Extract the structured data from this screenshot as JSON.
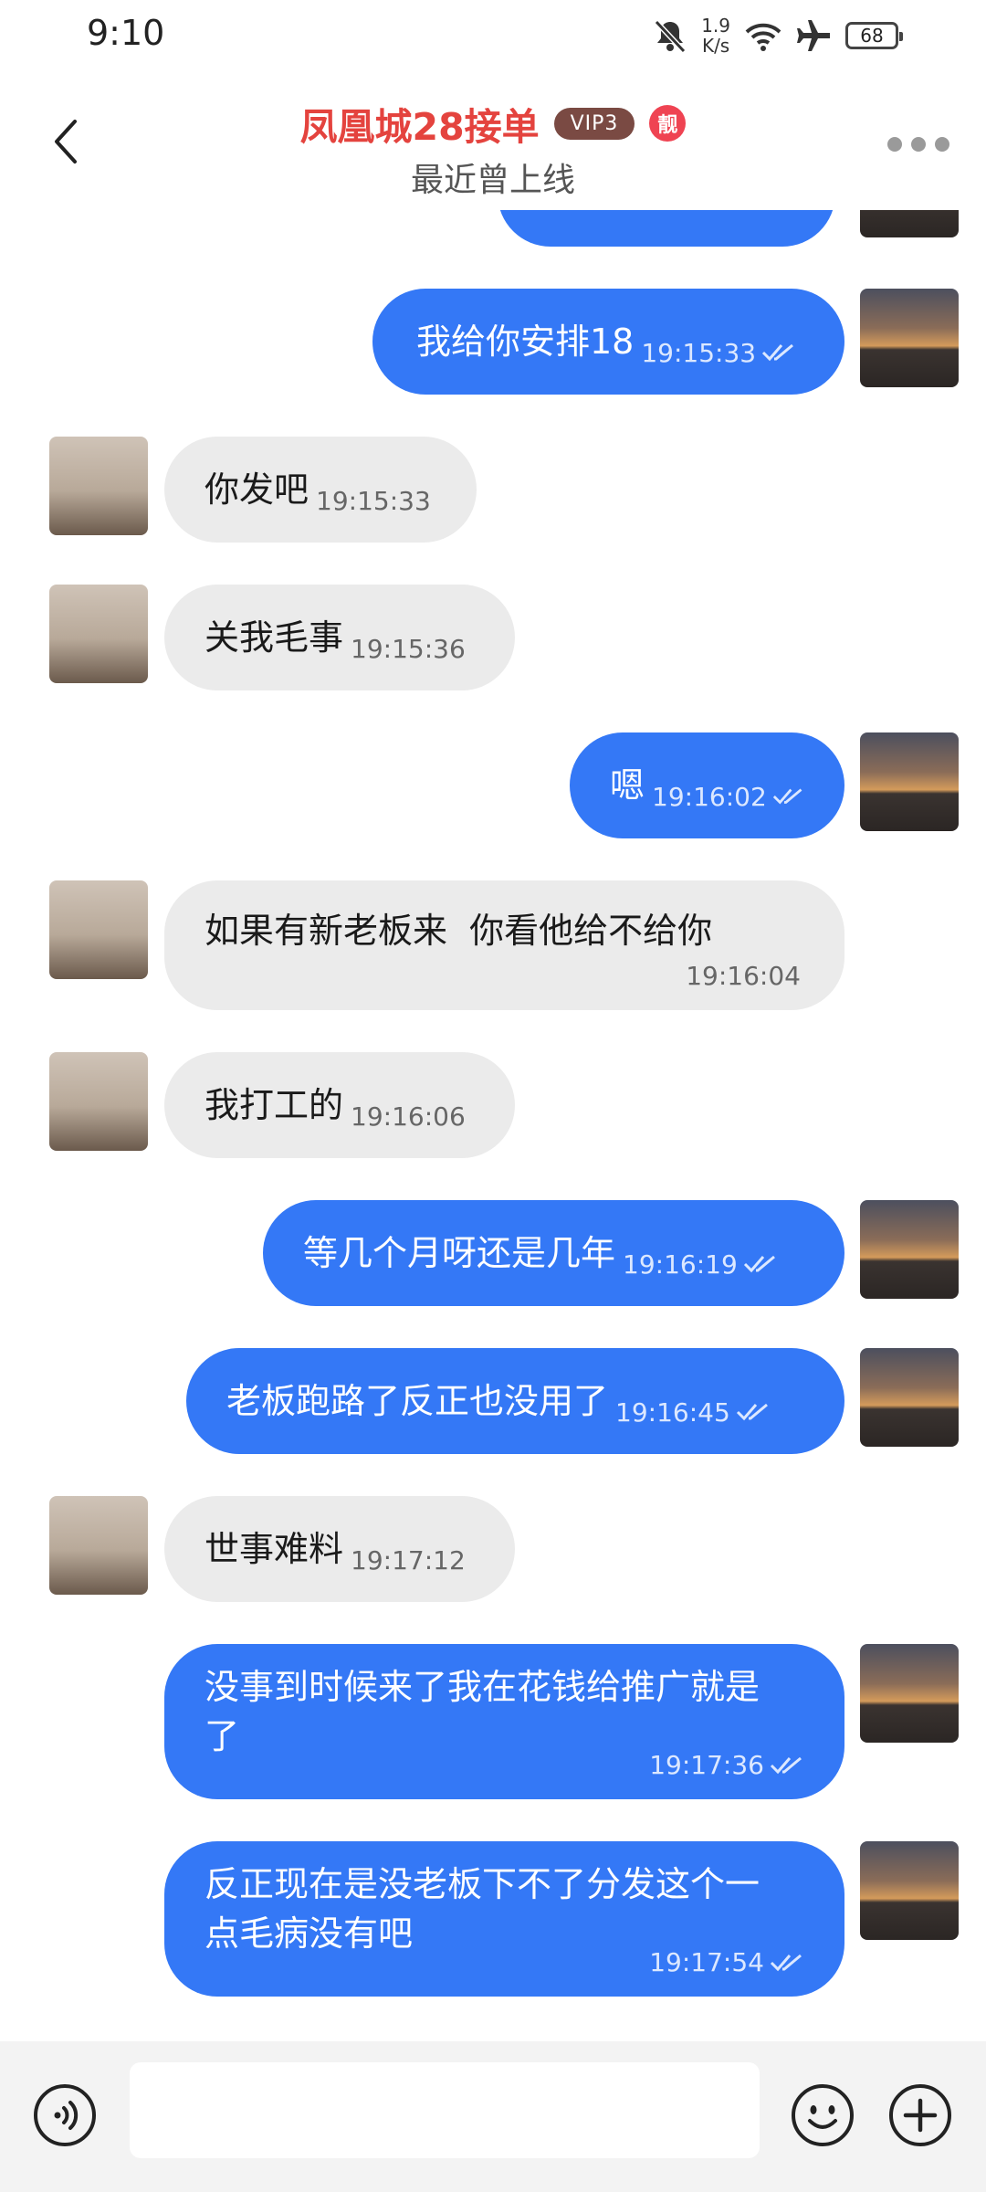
{
  "status": {
    "time": "9:10",
    "net_speed_value": "1.9",
    "net_speed_unit": "K/s",
    "battery": "68",
    "icons": [
      "mute-bell-icon",
      "net-speed-icon",
      "wifi-icon",
      "airplane-icon",
      "battery-icon"
    ]
  },
  "header": {
    "title": "凤凰城28接单",
    "vip_badge": "VIP3",
    "special_badge": "靓",
    "subtitle": "最近曾上线",
    "colors": {
      "title": "#e4433e",
      "vip_bg": "#7a4a43",
      "badge_bg": "#ef4352"
    }
  },
  "messages": [
    {
      "side": "out",
      "text": "我给你安排18",
      "time": "19:15:33"
    },
    {
      "side": "in",
      "text": "你发吧",
      "time": "19:15:33"
    },
    {
      "side": "in",
      "text": "关我毛事",
      "time": "19:15:36"
    },
    {
      "side": "out",
      "text": "嗯",
      "time": "19:16:02"
    },
    {
      "side": "in",
      "text": "如果有新老板来  你看他给不给你",
      "time": "19:16:04"
    },
    {
      "side": "in",
      "text": "我打工的",
      "time": "19:16:06"
    },
    {
      "side": "out",
      "text": "等几个月呀还是几年",
      "time": "19:16:19"
    },
    {
      "side": "out",
      "text": "老板跑路了反正也没用了",
      "time": "19:16:45"
    },
    {
      "side": "in",
      "text": "世事难料",
      "time": "19:17:12"
    },
    {
      "side": "out",
      "text": "没事到时候来了我在花钱给推广就是了",
      "time": "19:17:36"
    },
    {
      "side": "out",
      "text": "反正现在是没老板下不了分发这个一点毛病没有吧",
      "time": "19:17:54"
    }
  ],
  "bottom": {
    "input_placeholder": "",
    "icons": [
      "voice-icon",
      "emoji-icon",
      "plus-icon"
    ]
  },
  "colors": {
    "outgoing_bubble": "#3478f6",
    "incoming_bubble": "#ebebeb",
    "bottom_bar": "#f3f3f3"
  }
}
